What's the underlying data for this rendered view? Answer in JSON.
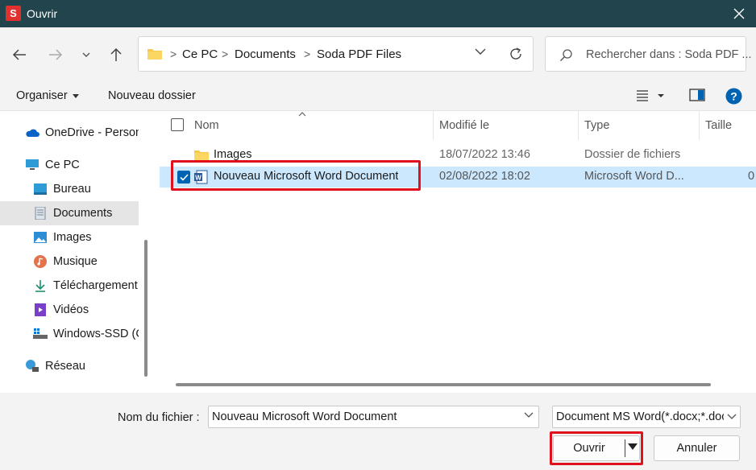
{
  "window": {
    "title": "Ouvrir",
    "logo_letter": "S"
  },
  "address": {
    "breadcrumbs": [
      "Ce PC",
      "Documents",
      "Soda PDF Files"
    ],
    "separator": ">"
  },
  "search": {
    "placeholder": "Rechercher dans : Soda PDF ..."
  },
  "toolbar": {
    "organise_label": "Organiser",
    "new_folder_label": "Nouveau dossier"
  },
  "sidebar": {
    "items": [
      {
        "label": "OneDrive - Person",
        "icon": "onedrive-icon"
      },
      {
        "label": "Ce PC",
        "icon": "computer-icon"
      },
      {
        "label": "Bureau",
        "icon": "desktop-icon"
      },
      {
        "label": "Documents",
        "icon": "documents-icon",
        "selected": true
      },
      {
        "label": "Images",
        "icon": "pictures-icon"
      },
      {
        "label": "Musique",
        "icon": "music-icon"
      },
      {
        "label": "Téléchargement",
        "icon": "download-icon"
      },
      {
        "label": "Vidéos",
        "icon": "videos-icon"
      },
      {
        "label": "Windows-SSD (C",
        "icon": "drive-icon"
      },
      {
        "label": "Réseau",
        "icon": "network-icon"
      }
    ]
  },
  "filelist": {
    "columns": {
      "name": "Nom",
      "modified": "Modifié le",
      "type": "Type",
      "size": "Taille"
    },
    "rows": [
      {
        "name": "Images",
        "modified": "18/07/2022 13:46",
        "type": "Dossier de fichiers",
        "size": "",
        "icon": "folder-icon",
        "selected": false
      },
      {
        "name": "Nouveau Microsoft Word Document",
        "modified": "02/08/2022 18:02",
        "type": "Microsoft Word D...",
        "size": "0",
        "icon": "word-document-icon",
        "selected": true
      }
    ]
  },
  "footer": {
    "filename_label": "Nom du fichier :",
    "filename_value": "Nouveau Microsoft Word Document",
    "filetype_value": "Document MS Word(*.docx;*.doc",
    "open_label": "Ouvrir",
    "cancel_label": "Annuler"
  },
  "colors": {
    "titlebar": "#22444d",
    "accent": "#0063b1",
    "selection": "#cce8ff",
    "highlight_box": "#e0101c",
    "logo": "#e0312f"
  }
}
